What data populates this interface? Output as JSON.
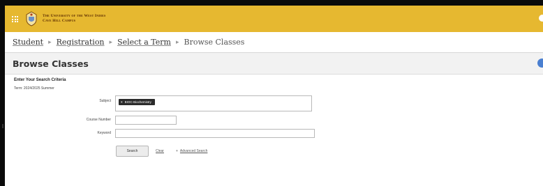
{
  "header": {
    "institution_line1": "The University of the West Indies",
    "institution_line2": "Cave Hill Campus"
  },
  "breadcrumb": {
    "items": [
      "Student",
      "Registration",
      "Select a Term"
    ],
    "current": "Browse Classes",
    "separator": "▸"
  },
  "page": {
    "title": "Browse Classes"
  },
  "form": {
    "criteria_title": "Enter Your Search Criteria",
    "term": "Term: 2024/2025 Summer",
    "subject_label": "Subject",
    "subject_selected": "BIOC-Biochemistry",
    "course_number_label": "Course Number",
    "course_number_value": "",
    "keyword_label": "Keyword",
    "keyword_value": "",
    "search_label": "Search",
    "clear_label": "Clear",
    "advanced_label": "Advanced Search",
    "advanced_prefix": "+"
  },
  "colors": {
    "header_bg": "#e6b830",
    "chip_bg": "#2b2b2b",
    "help_icon": "#4a7fd0"
  }
}
